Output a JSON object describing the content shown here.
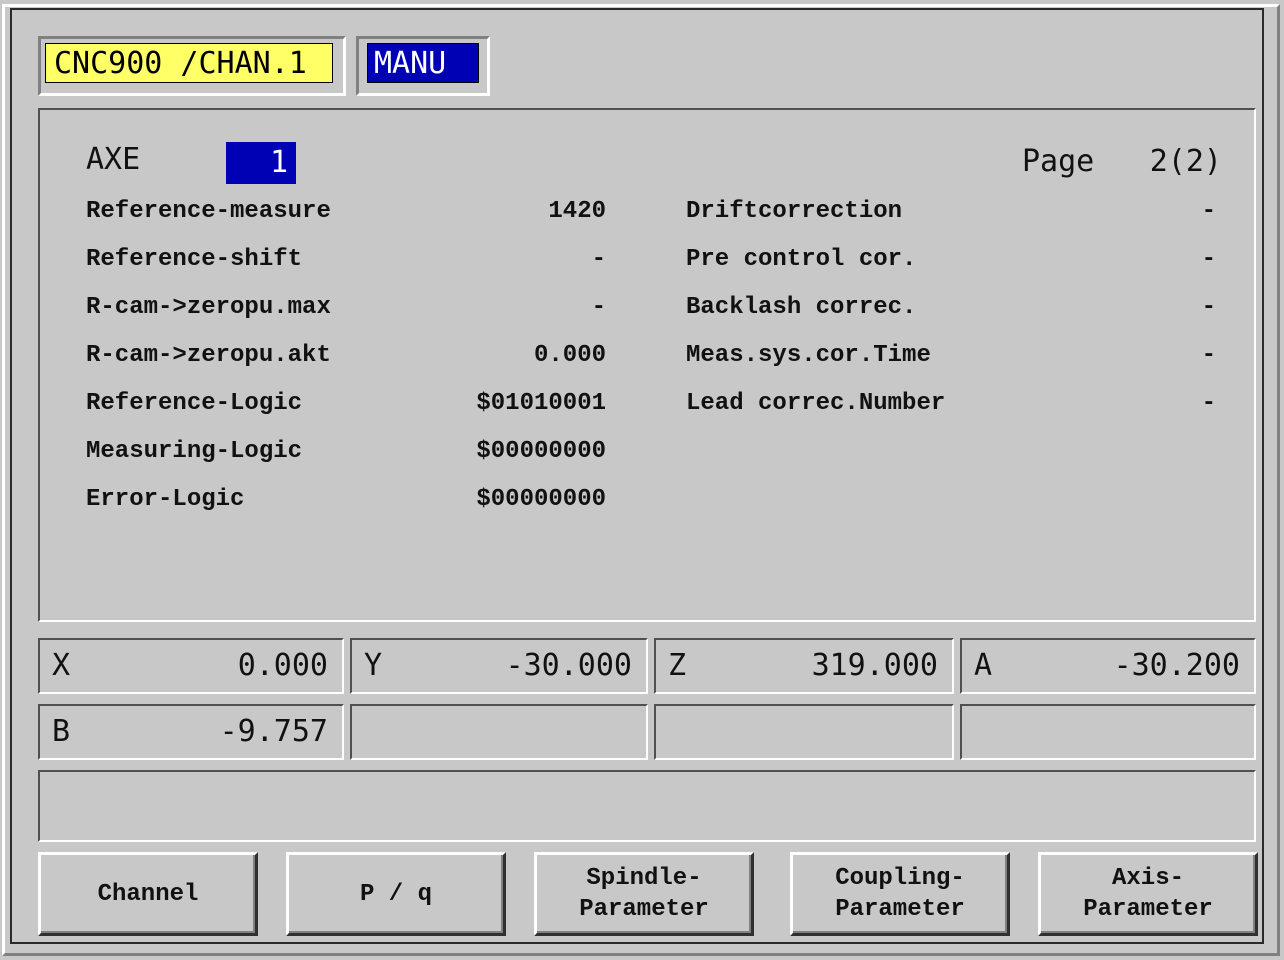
{
  "header": {
    "channel": "CNC900 /CHAN.1",
    "mode": "MANU"
  },
  "main": {
    "axe_label": "AXE",
    "axe_value": "1",
    "page_label": "Page",
    "page_value": "2(2)",
    "left_params": [
      {
        "label": "Reference-measure",
        "value": "1420"
      },
      {
        "label": "Reference-shift",
        "value": "-"
      },
      {
        "label": "R-cam->zeropu.max",
        "value": "-"
      },
      {
        "label": "R-cam->zeropu.akt",
        "value": "0.000"
      },
      {
        "label": "Reference-Logic",
        "value": "$01010001"
      },
      {
        "label": "Measuring-Logic",
        "value": "$00000000"
      },
      {
        "label": "Error-Logic",
        "value": "$00000000"
      }
    ],
    "right_params": [
      {
        "label": "Driftcorrection",
        "value": "-"
      },
      {
        "label": "Pre control cor.",
        "value": "-"
      },
      {
        "label": "Backlash correc.",
        "value": "-"
      },
      {
        "label": "Meas.sys.cor.Time",
        "value": "-"
      },
      {
        "label": "Lead correc.Number",
        "value": "-"
      }
    ]
  },
  "positions": [
    {
      "axis": "X",
      "value": "0.000"
    },
    {
      "axis": "Y",
      "value": "-30.000"
    },
    {
      "axis": "Z",
      "value": "319.000"
    },
    {
      "axis": "A",
      "value": "-30.200"
    },
    {
      "axis": "B",
      "value": "-9.757"
    },
    {
      "axis": "",
      "value": ""
    },
    {
      "axis": "",
      "value": ""
    },
    {
      "axis": "",
      "value": ""
    }
  ],
  "message": "",
  "softkeys": [
    {
      "label": "Channel"
    },
    {
      "label": "P / q"
    },
    {
      "label": "Spindle-\nParameter"
    },
    {
      "label": "Coupling-\nParameter"
    },
    {
      "label": "Axis-\nParameter"
    }
  ]
}
